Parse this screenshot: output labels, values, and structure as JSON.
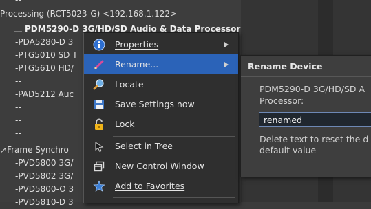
{
  "tree": {
    "rows": [
      {
        "label": "--"
      },
      {
        "label": "Processing (RCT5023-G) <192.168.1.122>"
      },
      {
        "label": "PDM5290-D 3G/HD/SD Audio & Data Processor"
      },
      {
        "label": "PDA5280-D 3"
      },
      {
        "label": "PTG5010 SD T"
      },
      {
        "label": "PTG5610 HD/"
      },
      {
        "label": "--"
      },
      {
        "label": "PAD5212 Auc"
      },
      {
        "label": "--"
      },
      {
        "label": "--"
      },
      {
        "label": "--"
      },
      {
        "label": "Frame Synchro"
      },
      {
        "label": "PVD5800 3G/"
      },
      {
        "label": "PVD5802 3G/"
      },
      {
        "label": "PVD5800-O 3"
      },
      {
        "label": "PVD5810-D 3"
      }
    ]
  },
  "context_menu": {
    "items": [
      {
        "label": "Properties",
        "icon": "info-icon",
        "submenu": true
      },
      {
        "label": "Rename...",
        "icon": "pencil-icon",
        "submenu": true,
        "highlighted": true
      },
      {
        "label": "Locate",
        "icon": "magnifier-icon"
      },
      {
        "label": "Save Settings now",
        "icon": "floppy-disk-icon"
      },
      {
        "label": "Lock",
        "icon": "padlock-icon"
      },
      {
        "label": "Select in Tree",
        "icon": "cursor-arrow-icon"
      },
      {
        "label": "New Control Window",
        "icon": "window-icon"
      },
      {
        "label": "Add to Favorites",
        "icon": "star-icon"
      }
    ]
  },
  "rename_panel": {
    "title": "Rename Device",
    "description": "PDM5290-D 3G/HD/SD A\nProcessor:",
    "input_value": "renamed",
    "hint": "Delete text to reset the d\ndefault value"
  },
  "colors": {
    "highlight": "#2b63b8",
    "menu_bg": "#2f2f2f",
    "tree_bg": "#3d3d3d"
  }
}
